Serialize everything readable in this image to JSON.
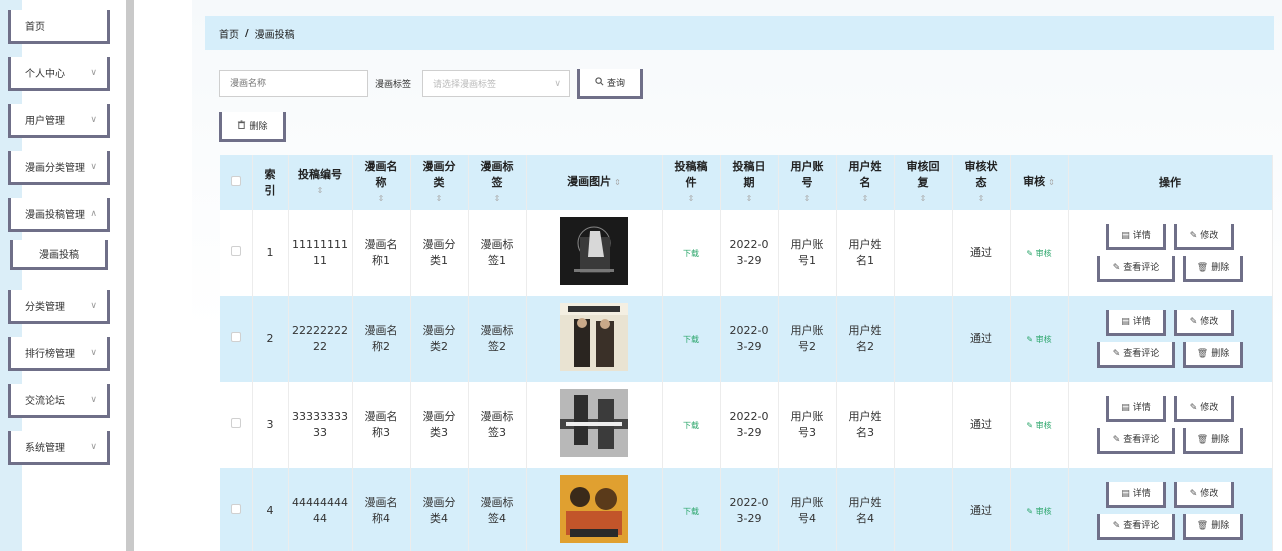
{
  "sidebar": {
    "items": [
      {
        "label": "首页",
        "has_chevron": false
      },
      {
        "label": "个人中心",
        "has_chevron": true
      },
      {
        "label": "用户管理",
        "has_chevron": true
      },
      {
        "label": "漫画分类管理",
        "has_chevron": true
      },
      {
        "label": "漫画投稿管理",
        "has_chevron": true
      },
      {
        "label": "分类管理",
        "has_chevron": true
      },
      {
        "label": "排行榜管理",
        "has_chevron": true
      },
      {
        "label": "交流论坛",
        "has_chevron": true
      },
      {
        "label": "系统管理",
        "has_chevron": true
      }
    ],
    "sub_item": "漫画投稿",
    "chevron": "∨"
  },
  "breadcrumb": {
    "home": "首页",
    "sep": "/",
    "current": "漫画投稿"
  },
  "filters": {
    "name_placeholder": "漫画名称",
    "tag_label": "漫画标签",
    "tag_placeholder": "请选择漫画标签",
    "query_label": "查询",
    "delete_label": "删除"
  },
  "table": {
    "headers": {
      "index": "索引",
      "code": "投稿编号",
      "name": "漫画名称",
      "category": "漫画分类",
      "tag": "漫画标签",
      "image": "漫画图片",
      "file": "投稿稿件",
      "date": "投稿日期",
      "account": "用户账号",
      "username": "用户姓名",
      "reply": "审核回复",
      "status": "审核状态",
      "audit": "审核",
      "ops": "操作"
    },
    "sort_glyph": "⇕",
    "rows": [
      {
        "index": "1",
        "code": "1111111111",
        "name": "漫画名称1",
        "category": "漫画分类1",
        "tag": "漫画标签1",
        "file": "下载",
        "date": "2022-03-29",
        "account": "用户账号1",
        "username": "用户姓名1",
        "reply": "",
        "status": "通过",
        "audit": "审核"
      },
      {
        "index": "2",
        "code": "2222222222",
        "name": "漫画名称2",
        "category": "漫画分类2",
        "tag": "漫画标签2",
        "file": "下载",
        "date": "2022-03-29",
        "account": "用户账号2",
        "username": "用户姓名2",
        "reply": "",
        "status": "通过",
        "audit": "审核"
      },
      {
        "index": "3",
        "code": "3333333333",
        "name": "漫画名称3",
        "category": "漫画分类3",
        "tag": "漫画标签3",
        "file": "下载",
        "date": "2022-03-29",
        "account": "用户账号3",
        "username": "用户姓名3",
        "reply": "",
        "status": "通过",
        "audit": "审核"
      },
      {
        "index": "4",
        "code": "4444444444",
        "name": "漫画名称4",
        "category": "漫画分类4",
        "tag": "漫画标签4",
        "file": "下载",
        "date": "2022-03-29",
        "account": "用户账号4",
        "username": "用户姓名4",
        "reply": "",
        "status": "通过",
        "audit": "审核"
      }
    ],
    "actions": {
      "detail": "详情",
      "edit": "修改",
      "comments": "查看评论",
      "delete": "删除"
    }
  },
  "colors": {
    "header_bg": "#d6eefa",
    "button_border": "#6f6f88",
    "link_green": "#2aa56a"
  },
  "icons": {
    "search": "search-icon",
    "trash": "trash-icon",
    "doc": "doc-icon",
    "pencil": "pencil-icon"
  }
}
